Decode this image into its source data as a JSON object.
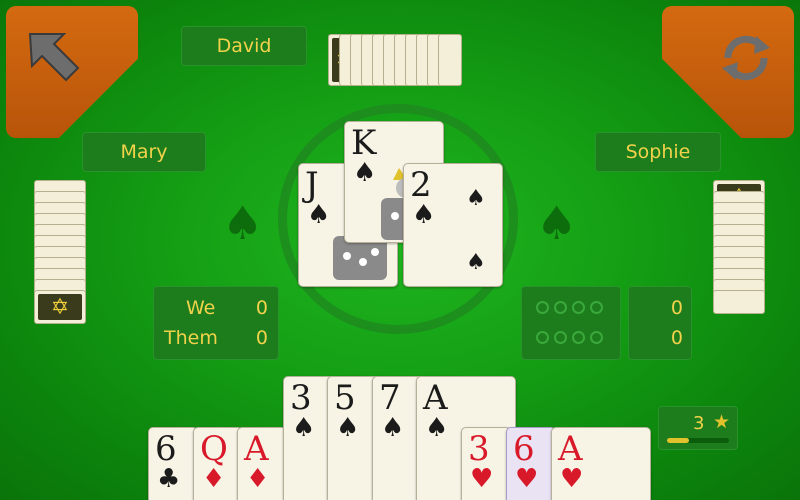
{
  "players": {
    "north": "David",
    "west": "Mary",
    "east": "Sophie"
  },
  "score": {
    "we_label": "We",
    "them_label": "Them",
    "we_value": "0",
    "them_value": "0",
    "right_top_value": "0",
    "right_bottom_value": "0"
  },
  "stars": {
    "count": "3",
    "icon": "star-icon",
    "progress": 0.35
  },
  "trick": [
    {
      "rank": "J",
      "suit": "♠",
      "color": "black"
    },
    {
      "rank": "K",
      "suit": "♠",
      "color": "black"
    },
    {
      "rank": "2",
      "suit": "♠",
      "color": "black"
    }
  ],
  "hand": [
    {
      "rank": "6",
      "suit": "♣",
      "color": "black"
    },
    {
      "rank": "Q",
      "suit": "♦",
      "color": "red"
    },
    {
      "rank": "A",
      "suit": "♦",
      "color": "red"
    },
    {
      "rank": "3",
      "suit": "♠",
      "color": "black"
    },
    {
      "rank": "5",
      "suit": "♠",
      "color": "black"
    },
    {
      "rank": "7",
      "suit": "♠",
      "color": "black"
    },
    {
      "rank": "A",
      "suit": "♠",
      "color": "black"
    },
    {
      "rank": "3",
      "suit": "♥",
      "color": "red"
    },
    {
      "rank": "6",
      "suit": "♥",
      "color": "red"
    },
    {
      "rank": "A",
      "suit": "♥",
      "color": "red"
    }
  ],
  "icons": {
    "back": "back-arrow-icon",
    "restart": "refresh-icon"
  },
  "colors": {
    "felt": "#15a015",
    "corner": "#c55e0d",
    "label": "#f1d24a"
  }
}
